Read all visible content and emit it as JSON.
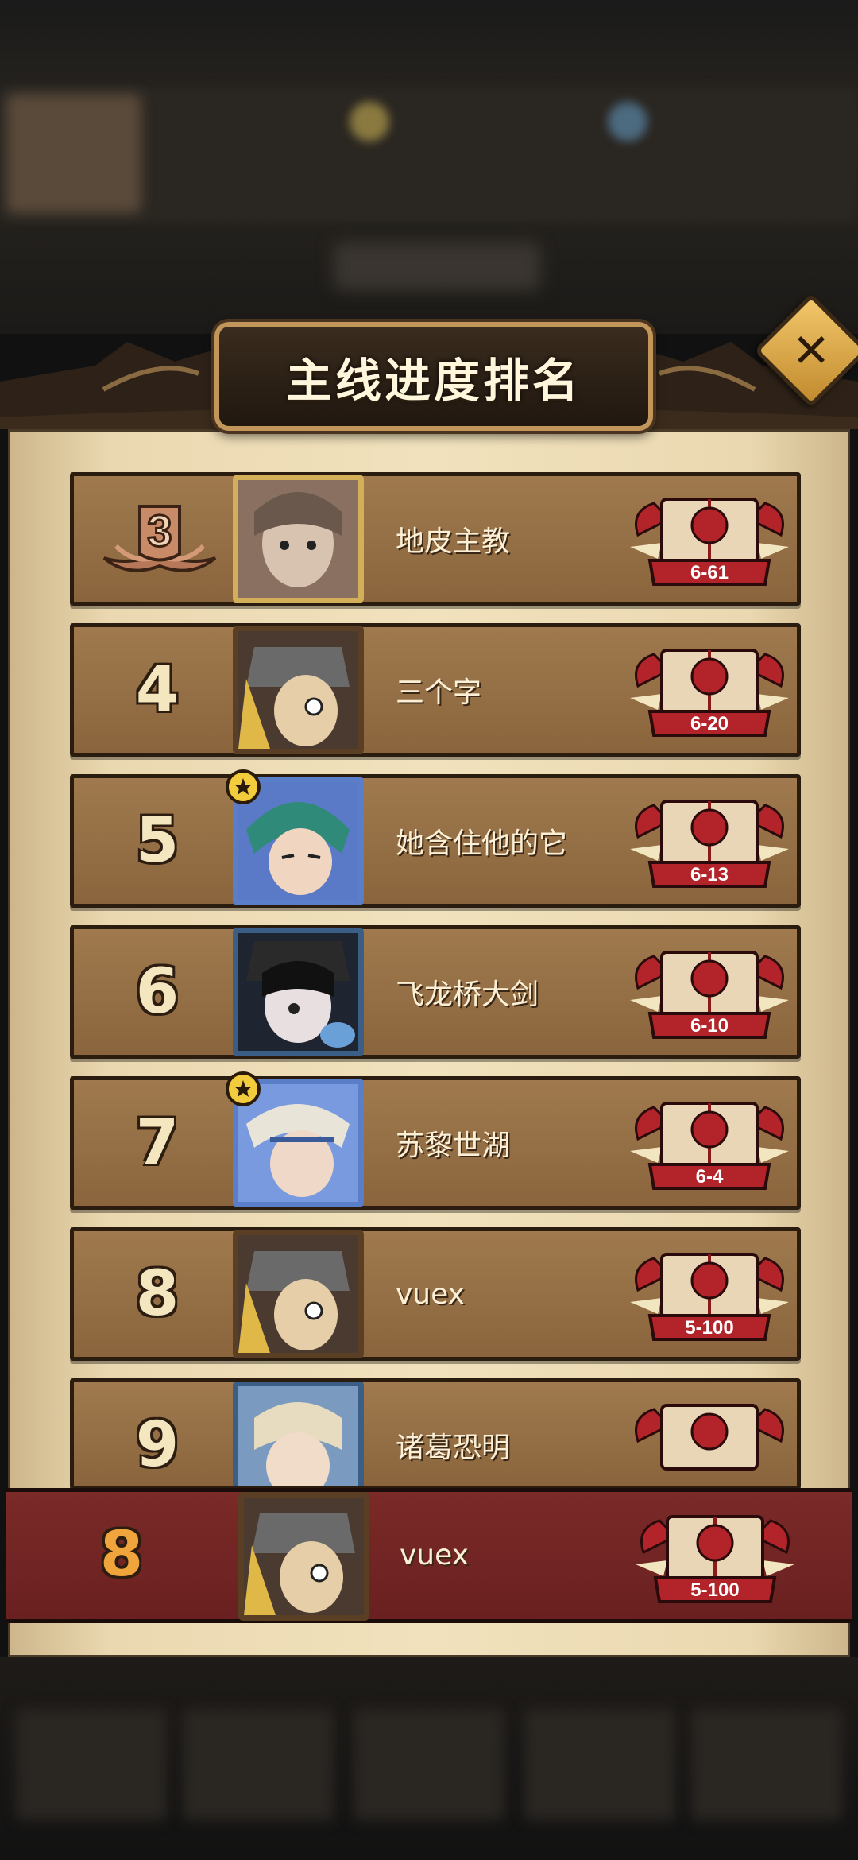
{
  "title": "主线进度排名",
  "close_label": "✕",
  "rows": [
    {
      "rank": "3",
      "name": "地皮主教",
      "stage": "6-61",
      "frame": "gold"
    },
    {
      "rank": "4",
      "name": "三个字",
      "stage": "6-20",
      "frame": "brown"
    },
    {
      "rank": "5",
      "name": "她含住他的它",
      "stage": "6-13",
      "frame": "blue"
    },
    {
      "rank": "6",
      "name": "飞龙桥大剑",
      "stage": "6-10",
      "frame": "dark"
    },
    {
      "rank": "7",
      "name": "苏黎世湖",
      "stage": "6-4",
      "frame": "blue"
    },
    {
      "rank": "8",
      "name": "vuex",
      "stage": "5-100",
      "frame": "brown"
    },
    {
      "rank": "9",
      "name": "诸葛恐明",
      "stage": "",
      "frame": "dark"
    }
  ],
  "my_rank": {
    "rank": "8",
    "name": "vuex",
    "stage": "5-100"
  },
  "colors": {
    "row_bg": "#8a643c",
    "my_row_bg": "#6a2020",
    "my_rank_color": "#f0a43c",
    "badge_red": "#b3242a"
  }
}
